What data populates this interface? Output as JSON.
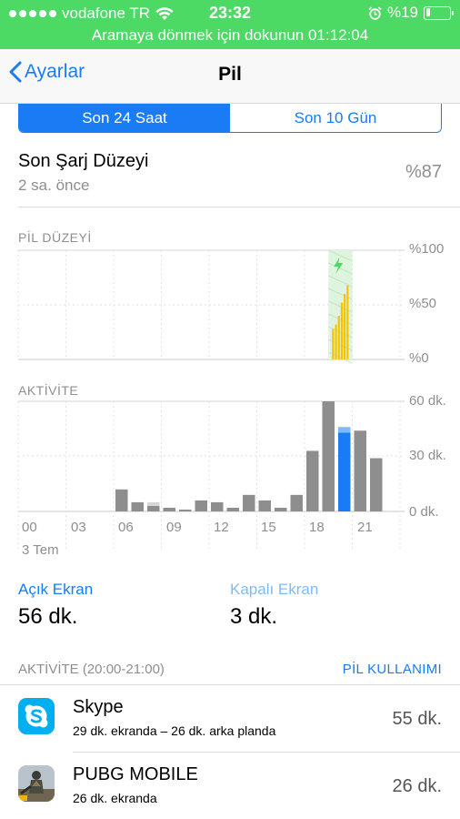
{
  "status_bar": {
    "carrier": "vodafone TR",
    "time": "23:32",
    "battery_text": "%19",
    "battery_level": 0.19,
    "call_banner": "Aramaya dönmek için dokunun 01:12:04",
    "bg_color": "#4cd964"
  },
  "nav": {
    "back_label": "Ayarlar",
    "title": "Pil"
  },
  "segments": {
    "left": "Son 24 Saat",
    "right": "Son 10 Gün",
    "selected": "left"
  },
  "last_charge": {
    "title": "Son Şarj Düzeyi",
    "ago": "2 sa. önce",
    "value": "%87"
  },
  "battery_chart": {
    "label": "PİL DÜZEYİ",
    "y_labels": [
      "%100",
      "%50",
      "%0"
    ],
    "charge_levels": [
      28,
      32,
      40,
      52,
      60,
      68
    ],
    "charging_icon": "bolt-icon"
  },
  "activity_chart": {
    "label": "AKTİVİTE",
    "y_labels": [
      "60 dk.",
      "30 dk.",
      "0 dk."
    ],
    "x_labels": [
      "00",
      "03",
      "06",
      "09",
      "12",
      "15",
      "18",
      "21"
    ],
    "date_label": "3 Tem",
    "hours": [
      6,
      7,
      8,
      9,
      10,
      11,
      12,
      13,
      14,
      15,
      16,
      17,
      18,
      19,
      20,
      21,
      22
    ],
    "screen_on": [
      12,
      5,
      3,
      2,
      1,
      6,
      5,
      2,
      9,
      6,
      2,
      9,
      33,
      60,
      43,
      44,
      29
    ],
    "screen_off": [
      0,
      0,
      2,
      0,
      0,
      0,
      0,
      0,
      0,
      0,
      0,
      0,
      0,
      0,
      3,
      0,
      0
    ],
    "selected_hour": 20,
    "colors": {
      "normal": "#8e8e8e",
      "selected": "#1a7cf5",
      "selected_light": "#7fbaf8"
    }
  },
  "stats": {
    "on_label": "Açık Ekran",
    "on_value": "56 dk.",
    "off_label": "Kapalı Ekran",
    "off_value": "3 dk."
  },
  "activity_list": {
    "header": "AKTİVİTE (20:00-21:00)",
    "link": "PİL KULLANIMI",
    "apps": [
      {
        "name": "Skype",
        "detail": "29 dk. ekranda – 26 dk. arka planda",
        "duration": "55 dk.",
        "icon": "skype-icon"
      },
      {
        "name": "PUBG MOBILE",
        "detail": "26 dk. ekranda",
        "duration": "26 dk.",
        "icon": "pubg-icon"
      }
    ]
  }
}
